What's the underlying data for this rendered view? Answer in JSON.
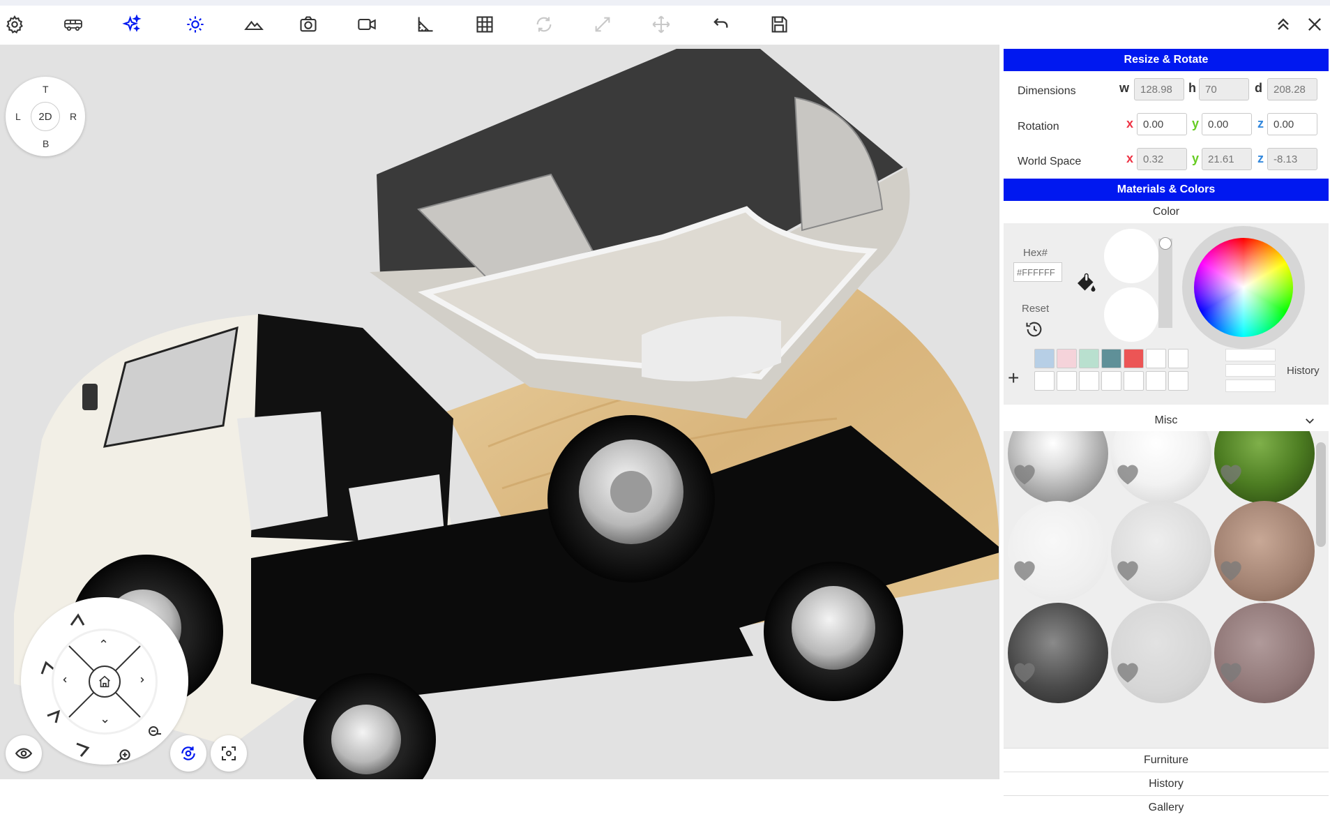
{
  "toolbar": {
    "left_icons": [
      "gear-icon",
      "van-icon",
      "sparkles-icon",
      "sun-icon",
      "terrain-icon",
      "camera-icon",
      "video-icon",
      "measure-icon",
      "grid-icon",
      "rotate-icon",
      "resize-icon",
      "move-icon",
      "undo-icon",
      "save-icon"
    ],
    "right_icons": [
      "collapse-up-icon",
      "close-icon"
    ],
    "active_color": "#0018f0",
    "disabled_color": "#c8c8c8"
  },
  "compass": {
    "top": "T",
    "bottom": "B",
    "left": "L",
    "right": "R",
    "center": "2D"
  },
  "resize_rotate": {
    "title": "Resize & Rotate",
    "dimensions": {
      "label": "Dimensions",
      "w_label": "w",
      "h_label": "h",
      "d_label": "d",
      "w": "128.98",
      "h": "70",
      "d": "208.28"
    },
    "rotation": {
      "label": "Rotation",
      "x_label": "x",
      "y_label": "y",
      "z_label": "z",
      "x": "0.00",
      "y": "0.00",
      "z": "0.00"
    },
    "world": {
      "label": "World Space",
      "x_label": "x",
      "y_label": "y",
      "z_label": "z",
      "x": "0.32",
      "y": "21.61",
      "z": "-8.13"
    }
  },
  "materials": {
    "title": "Materials & Colors",
    "color_label": "Color",
    "hex_label": "Hex#",
    "hex_placeholder": "#FFFFFF",
    "reset_label": "Reset",
    "history_label": "History",
    "swatch_colors": [
      "#b7cfe6",
      "#f5d3da",
      "#b9e0cf",
      "#5f9098",
      "#ec5555"
    ],
    "misc_label": "Misc",
    "accordions": [
      "Furniture",
      "History",
      "Gallery"
    ]
  },
  "axis_colors": {
    "x": "#ee3344",
    "y": "#66cc22",
    "z": "#3388dd"
  }
}
